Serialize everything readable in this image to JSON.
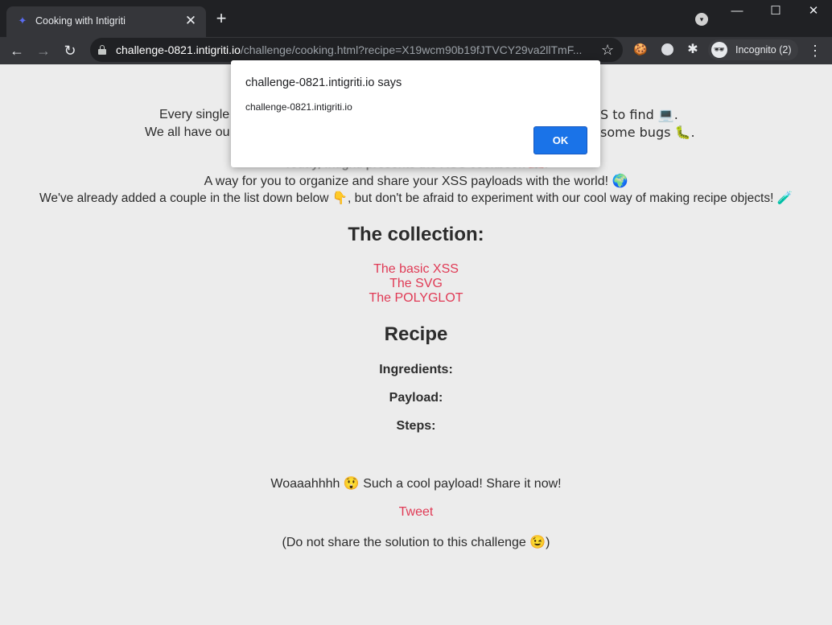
{
  "browser": {
    "tab_title": "Cooking with Intigriti",
    "tab_close": "✕",
    "new_tab": "+",
    "tab_search": "▾",
    "window_min": "—",
    "window_max": "☐",
    "window_close": "✕",
    "url_host": "challenge-0821.intigriti.io",
    "url_rest": "/challenge/cooking.html?recipe=X19wcm90b19fJTVCY29va2llTmF...",
    "incognito_label": "Incognito (2)",
    "icons": {
      "back": "←",
      "forward": "→",
      "reload": "↻",
      "star": "☆",
      "cookie": "🍪",
      "puzzle": "✱",
      "incognito": "🕶",
      "menu": "⋮",
      "favicon": "✦"
    }
  },
  "page": {
    "intro_line1_start": "Every single",
    "intro_line1_end": "S to find 💻.",
    "intro_line2_start": "We all have ou",
    "intro_line2_end": "some bugs 🐛.",
    "intro_line3": "Today, Intigriti presents the XSS cookbook 📖.",
    "intro_line4": "A way for you to organize and share your XSS payloads with the world! 🌍",
    "intro_line5": "We've already added a couple in the list down below 👇, but don't be afraid to experiment with our cool way of making recipe objects! 🧪",
    "collection_heading": "The collection:",
    "recipes": [
      "The basic XSS",
      "The SVG",
      "The POLYGLOT"
    ],
    "recipe_heading": "Recipe",
    "ingredients_label": "Ingredients:",
    "payload_label": "Payload:",
    "steps_label": "Steps:",
    "share_text": "Woaaahhhh 😲 Such a cool payload! Share it now!",
    "tweet_label": "Tweet",
    "disclaimer": "(Do not share the solution to this challenge 😉)"
  },
  "dialog": {
    "title": "challenge-0821.intigriti.io says",
    "message": "challenge-0821.intigriti.io",
    "ok_label": "OK"
  },
  "colors": {
    "link": "#e03a55",
    "dialog_button": "#1a73e8",
    "page_background": "#ececec",
    "chrome_dark": "#202124",
    "chrome_toolbar": "#35363a"
  }
}
